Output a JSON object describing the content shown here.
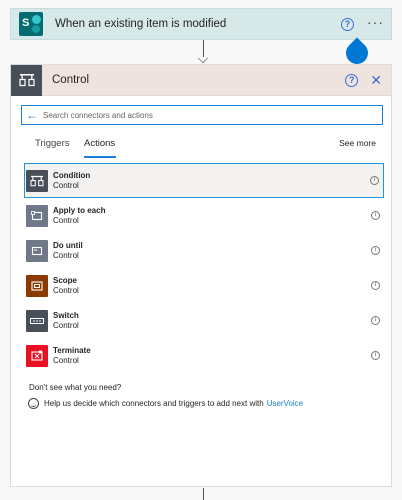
{
  "trigger": {
    "title": "When an existing item is modified",
    "app_icon": "sharepoint-icon",
    "help_label": "?",
    "more_label": "···"
  },
  "control_card": {
    "title": "Control",
    "help_label": "?",
    "close_label": "✕",
    "search_placeholder": "Search connectors and actions",
    "tabs": [
      {
        "label": "Triggers",
        "active": false
      },
      {
        "label": "Actions",
        "active": true
      }
    ],
    "see_more_label": "See more",
    "items": [
      {
        "name": "Condition",
        "sub": "Control",
        "icon": "condition-icon",
        "color": "#484f58",
        "selected": true
      },
      {
        "name": "Apply to each",
        "sub": "Control",
        "icon": "apply-to-each-icon",
        "color": "#6e7886",
        "selected": false
      },
      {
        "name": "Do until",
        "sub": "Control",
        "icon": "do-until-icon",
        "color": "#6e7886",
        "selected": false
      },
      {
        "name": "Scope",
        "sub": "Control",
        "icon": "scope-icon",
        "color": "#8b3a00",
        "selected": false
      },
      {
        "name": "Switch",
        "sub": "Control",
        "icon": "switch-icon",
        "color": "#484f58",
        "selected": false
      },
      {
        "name": "Terminate",
        "sub": "Control",
        "icon": "terminate-icon",
        "color": "#e81123",
        "selected": false
      }
    ],
    "info_label": "i",
    "footer": {
      "question": "Don't see what you need?",
      "help_text": "Help us decide which connectors and triggers to add next with",
      "link_text": "UserVoice"
    }
  },
  "colors": {
    "trigger_bg": "#d6e8e8",
    "control_header_bg": "#efe3df",
    "accent": "#1a7fd8",
    "drop": "#0078d4"
  }
}
